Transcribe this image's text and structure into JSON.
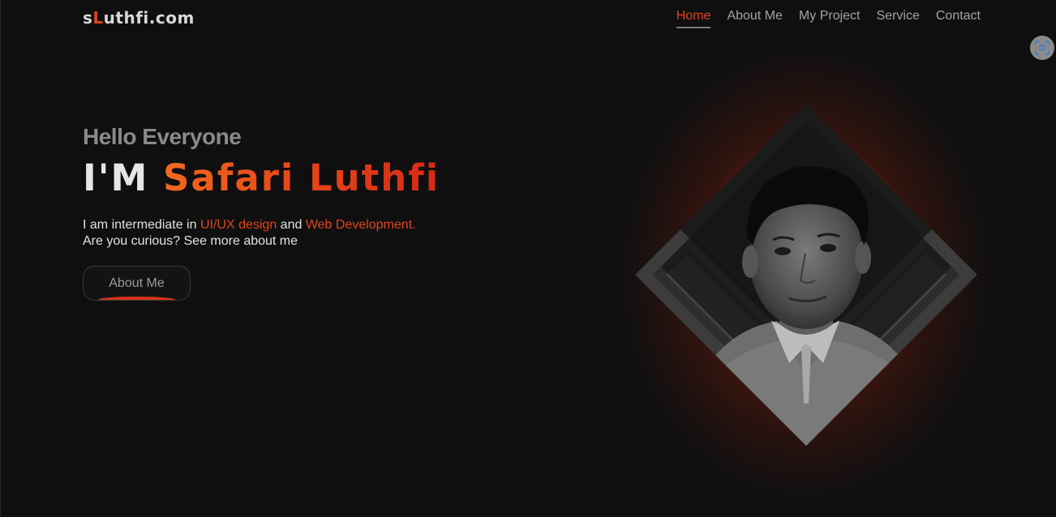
{
  "header": {
    "logo_prefix": "s",
    "logo_accent": "L",
    "logo_suffix": "uthfi.com",
    "nav": [
      {
        "label": "Home",
        "active": true
      },
      {
        "label": "About Me",
        "active": false
      },
      {
        "label": "My Project",
        "active": false
      },
      {
        "label": "Service",
        "active": false
      },
      {
        "label": "Contact",
        "active": false
      }
    ]
  },
  "hero": {
    "greeting": "Hello Everyone",
    "headline_prefix": "I'M ",
    "headline_name": "Safari Luthfi",
    "desc_part1": "I am intermediate in ",
    "desc_highlight1": "UI/UX design",
    "desc_part2": " and ",
    "desc_highlight2": "Web Development.",
    "desc_line2": "Are you curious? See more about me",
    "button_label": "About Me"
  },
  "icons": {
    "capture": "screenshot-capture-icon",
    "portrait": "profile-portrait"
  },
  "colors": {
    "accent": "#e0441c",
    "background": "#0f0f10",
    "nav_text": "#a3a3a3"
  }
}
